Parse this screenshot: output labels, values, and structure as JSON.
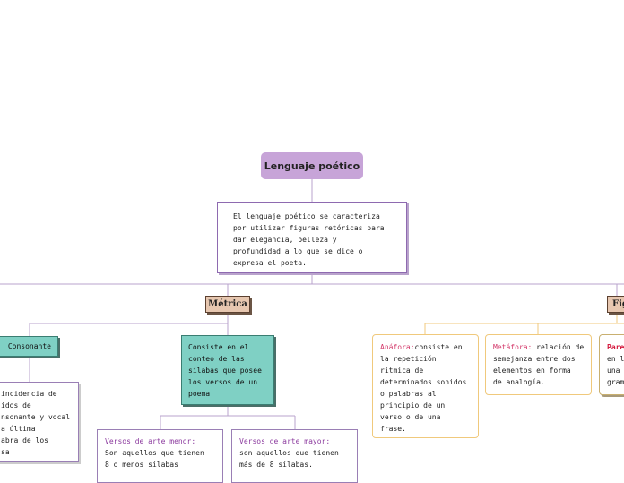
{
  "root": {
    "title": "Lenguaje poético"
  },
  "description": {
    "lines": [
      "El lenguaje poético se caracteriza",
      "por utilizar figuras retóricas para",
      "dar elegancia, belleza y",
      "profundidad a lo que se dice o",
      "expresa el poeta."
    ]
  },
  "metrica": {
    "label": "Métrica",
    "consonante": "Consonante",
    "incidencia_lines": [
      "incidencia de",
      "idos de",
      "nsonante y vocal",
      "a última",
      "abra de los",
      "sa"
    ],
    "conteo_lines": [
      "Consiste en el",
      "conteo de las",
      "sílabas que posee",
      "los versos de un",
      "poema"
    ],
    "menor": {
      "title": "Versos de arte menor:",
      "lines": [
        "Son aquellos que tienen",
        "8 o menos sílabas"
      ]
    },
    "mayor": {
      "title": "Versos de arte mayor:",
      "lines": [
        "son aquellos que tienen",
        "más de 8 sílabas."
      ]
    }
  },
  "figuras": {
    "label": "Fig",
    "anafora": {
      "term": "Anáfora:",
      "first": "consiste en",
      "lines": [
        "la repetición",
        "rítmica de",
        "determinados sonidos",
        "o palabras al",
        "principio de un",
        "verso o de una",
        "frase."
      ]
    },
    "metafora": {
      "term": "Metáfora:",
      "first": " relación de",
      "lines": [
        "semejanza entre dos",
        "elementos en forma",
        "de analogía."
      ]
    },
    "otra": {
      "term": "Pare",
      "lines": [
        "en l",
        "una",
        "gram"
      ]
    }
  },
  "colors": {
    "root": "#c7a4d8",
    "connector": "#b9a3cc",
    "tag": "#e7c7b0",
    "teal": "#7fd0c4",
    "orange_connector": "#f0c97c"
  }
}
